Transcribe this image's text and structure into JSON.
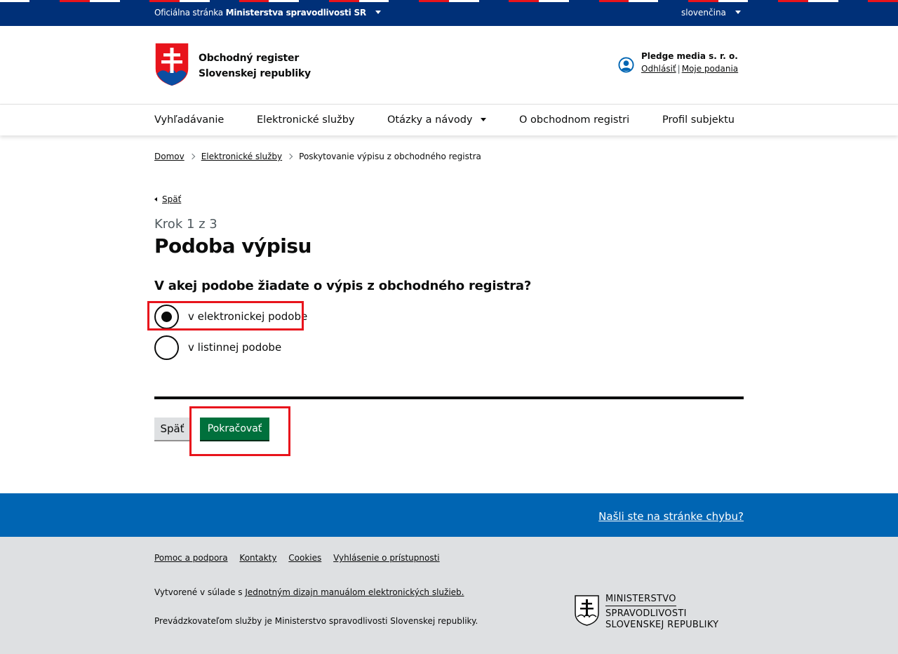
{
  "topbar": {
    "official_prefix": "Oficiálna stránka",
    "official_org": "Ministerstva spravodlivosti SR",
    "language": "slovenčina"
  },
  "header": {
    "title_line1": "Obchodný register",
    "title_line2": "Slovenskej republiky",
    "user_name": "Pledge media s. r. o.",
    "logout": "Odhlásiť",
    "separator": "|",
    "my_submissions": "Moje podania"
  },
  "nav": {
    "items": [
      "Vyhľadávanie",
      "Elektronické služby",
      "Otázky a návody",
      "O obchodnom registri",
      "Profil subjektu"
    ]
  },
  "breadcrumb": {
    "home": "Domov",
    "services": "Elektronické služby",
    "current": "Poskytovanie výpisu z obchodného registra"
  },
  "main": {
    "back_link": "Späť",
    "step": "Krok 1 z 3",
    "title": "Podoba výpisu",
    "question": "V akej podobe žiadate o výpis z obchodného registra?",
    "options": [
      {
        "label": "v elektronickej podobe",
        "checked": true
      },
      {
        "label": "v listinnej podobe",
        "checked": false
      }
    ],
    "back_button": "Späť",
    "continue_button": "Pokračovať"
  },
  "footer": {
    "bug_link": "Našli ste na stránke chybu?",
    "links": [
      "Pomoc a podpora",
      "Kontakty",
      "Cookies",
      "Vyhlásenie o prístupnosti"
    ],
    "created_prefix": "Vytvorené v súlade s",
    "created_link": "Jednotným dizajn manuálom elektronických služieb.",
    "operator": "Prevádzkovateľom služby je Ministerstvo spravodlivosti Slovenskej republiky.",
    "ministry_line1": "MINISTERSTVO",
    "ministry_line2": "SPRAVODLIVOSTI",
    "ministry_line3": "SLOVENSKEJ REPUBLIKY"
  },
  "colors": {
    "topbar": "#003078",
    "flag_red": "#e8141c",
    "flag_white": "#ffffff",
    "primary_button": "#00703c",
    "bug_bar": "#0065b3",
    "footer": "#dee0e2",
    "highlight": "#e8141c"
  }
}
